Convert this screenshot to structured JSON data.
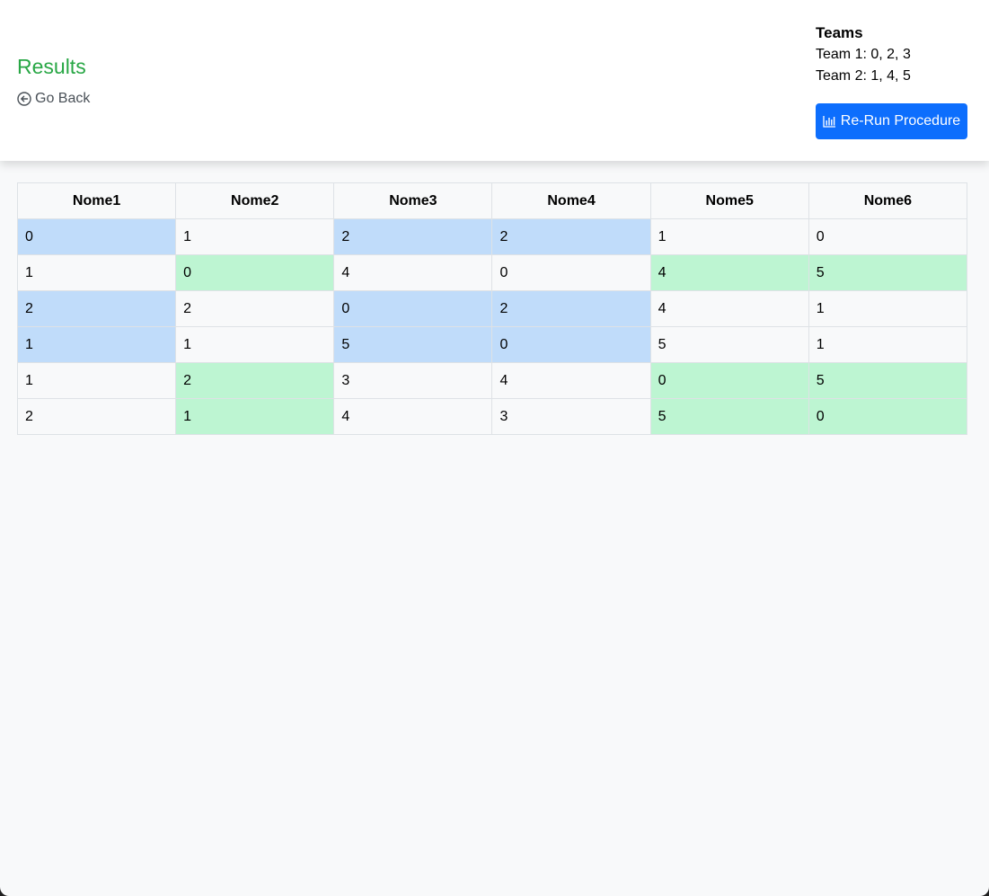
{
  "header": {
    "title": "Results",
    "go_back_label": "Go Back",
    "teams_title": "Teams",
    "team1_line": "Team 1: 0, 2, 3",
    "team2_line": "Team 2: 1, 4, 5",
    "rerun_label": "Re-Run Procedure"
  },
  "colors": {
    "title": "#28a745",
    "button": "#0d6efd",
    "team1_cell": "#c0dcfa",
    "team2_cell": "#bdf5d2",
    "page_bg": "#f8f9fa"
  },
  "table": {
    "columns": [
      "Nome1",
      "Nome2",
      "Nome3",
      "Nome4",
      "Nome5",
      "Nome6"
    ],
    "rows": [
      {
        "cells": [
          "0",
          "1",
          "2",
          "2",
          "1",
          "0"
        ],
        "team": "1",
        "team_cols": [
          0,
          2,
          3
        ]
      },
      {
        "cells": [
          "1",
          "0",
          "4",
          "0",
          "4",
          "5"
        ],
        "team": "2",
        "team_cols": [
          1,
          4,
          5
        ]
      },
      {
        "cells": [
          "2",
          "2",
          "0",
          "2",
          "4",
          "1"
        ],
        "team": "1",
        "team_cols": [
          0,
          2,
          3
        ]
      },
      {
        "cells": [
          "1",
          "1",
          "5",
          "0",
          "5",
          "1"
        ],
        "team": "1",
        "team_cols": [
          0,
          2,
          3
        ]
      },
      {
        "cells": [
          "1",
          "2",
          "3",
          "4",
          "0",
          "5"
        ],
        "team": "2",
        "team_cols": [
          1,
          4,
          5
        ]
      },
      {
        "cells": [
          "2",
          "1",
          "4",
          "3",
          "5",
          "0"
        ],
        "team": "2",
        "team_cols": [
          1,
          4,
          5
        ]
      }
    ]
  }
}
